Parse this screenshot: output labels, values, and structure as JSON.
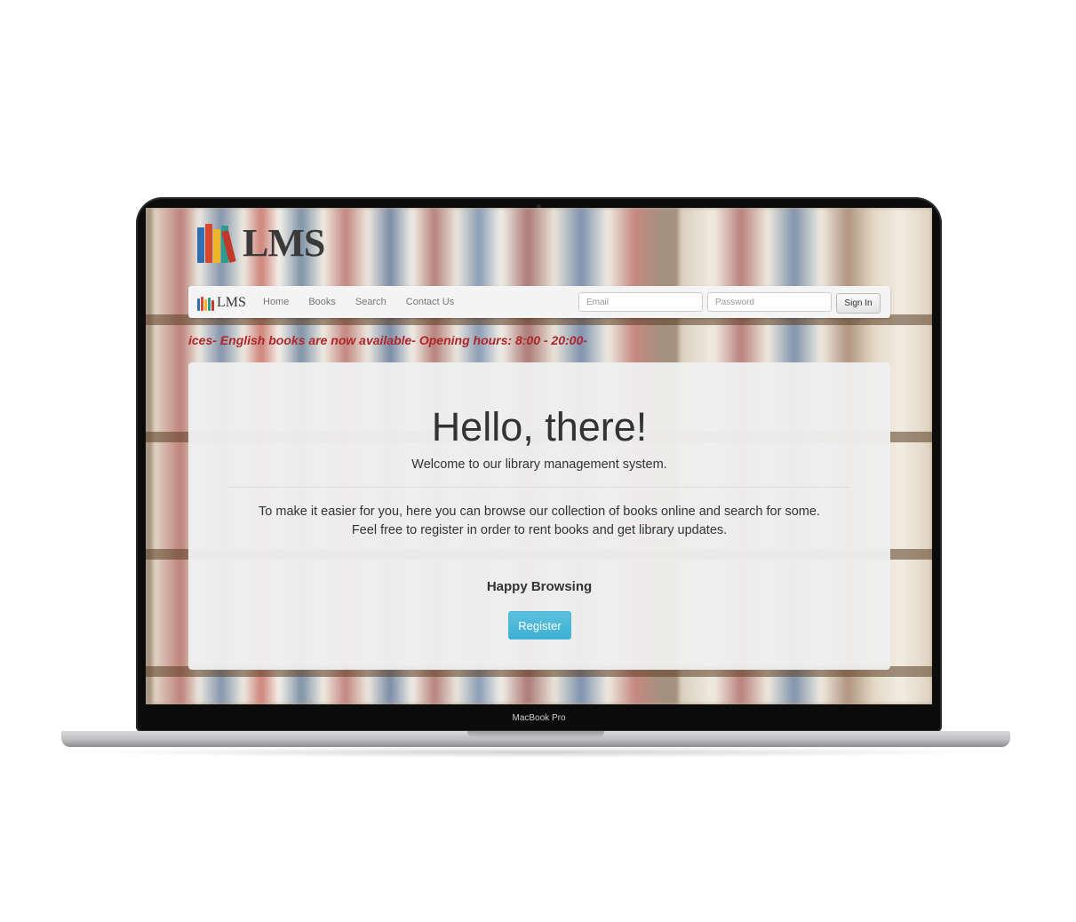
{
  "device": {
    "label": "MacBook Pro"
  },
  "header": {
    "logo_text": "LMS"
  },
  "navbar": {
    "brand_text": "LMS",
    "links": [
      "Home",
      "Books",
      "Search",
      "Contact Us"
    ],
    "email_placeholder": "Email",
    "password_placeholder": "Password",
    "signin_label": "Sign In"
  },
  "ticker": {
    "text": "ices- English books are now available- Opening hours: 8:00 - 20:00-"
  },
  "jumbotron": {
    "title": "Hello, there!",
    "lead": "Welcome to our library management system.",
    "body_line1": "To make it easier for you, here you can browse our collection of books online and search for some.",
    "body_line2": "Feel free to register in order to rent books and get library updates.",
    "strong": "Happy Browsing",
    "register_label": "Register"
  },
  "colors": {
    "ticker": "#b0252a",
    "register_button": "#5bc0de",
    "logo_books": [
      "#2e6fb0",
      "#d9462a",
      "#f0b429",
      "#2a9d8f",
      "#c0392b",
      "#34495e"
    ]
  }
}
